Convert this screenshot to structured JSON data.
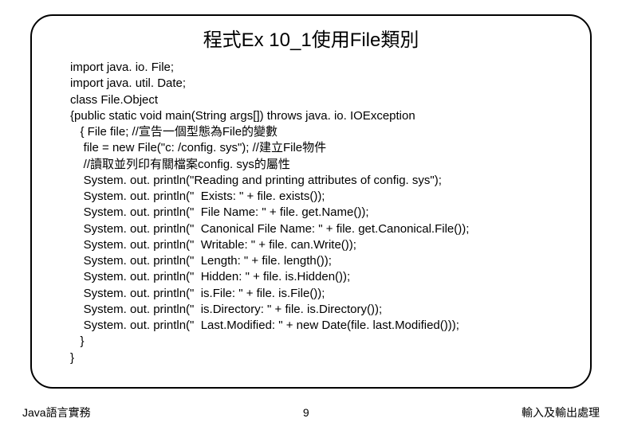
{
  "title": "程式Ex 10_1使用File類別",
  "code_lines": [
    "import java. io. File;",
    "import java. util. Date;",
    "class File.Object",
    "{public static void main(String args[]) throws java. io. IOException",
    "   { File file; //宣告一個型態為File的變數",
    "    file = new File(\"c: /config. sys\"); //建立File物件",
    "    //讀取並列印有關檔案config. sys的屬性",
    "    System. out. println(\"Reading and printing attributes of config. sys\");",
    "    System. out. println(\"  Exists: \" + file. exists());",
    "    System. out. println(\"  File Name: \" + file. get.Name());",
    "    System. out. println(\"  Canonical File Name: \" + file. get.Canonical.File());",
    "    System. out. println(\"  Writable: \" + file. can.Write());",
    "    System. out. println(\"  Length: \" + file. length());",
    "    System. out. println(\"  Hidden: \" + file. is.Hidden());",
    "    System. out. println(\"  is.File: \" + file. is.File());",
    "    System. out. println(\"  is.Directory: \" + file. is.Directory());",
    "    System. out. println(\"  Last.Modified: \" + new Date(file. last.Modified()));",
    "   }",
    "}"
  ],
  "footer": {
    "left": "Java語言實務",
    "center": "9",
    "right": "輸入及輸出處理"
  }
}
